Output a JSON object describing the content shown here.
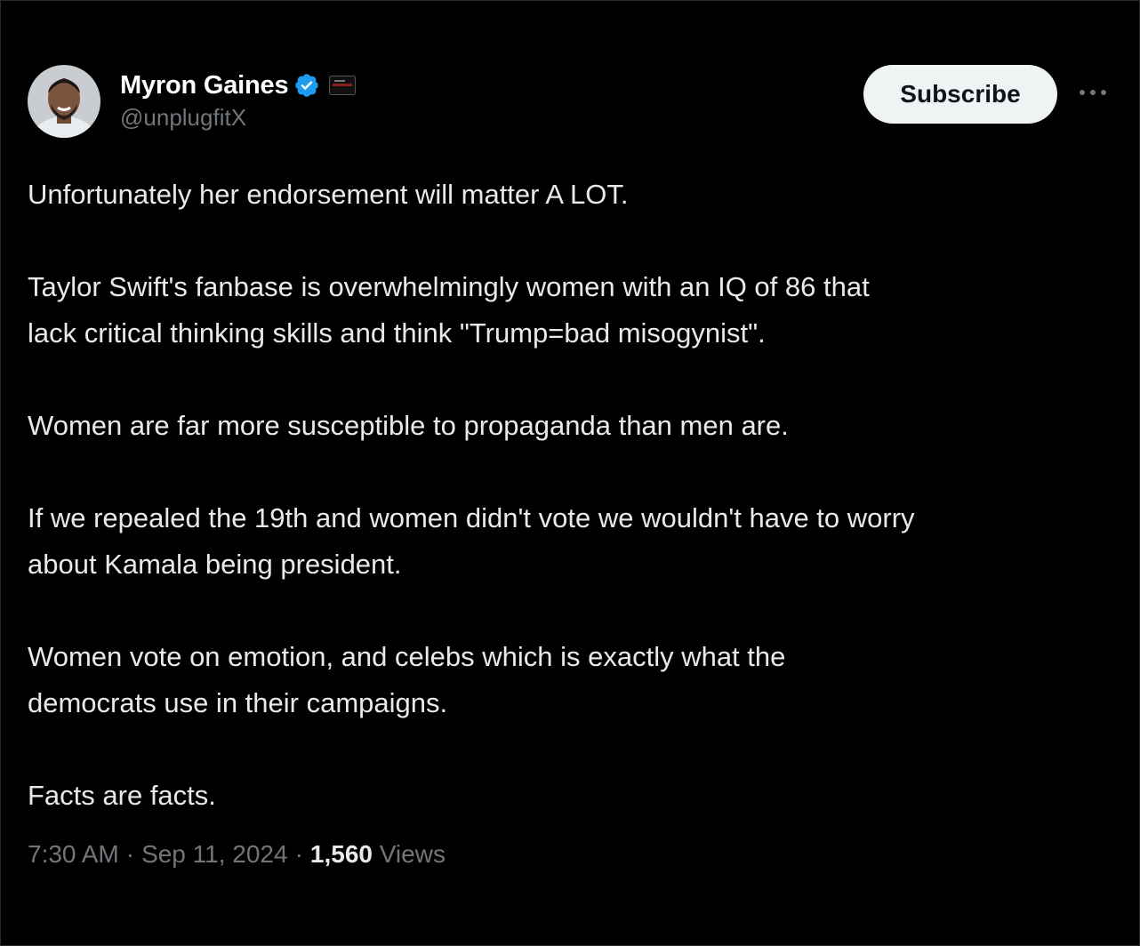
{
  "author": {
    "display_name": "Myron Gaines",
    "handle": "@unplugfitX",
    "verified": true,
    "verified_icon": "verified-badge-icon",
    "affiliate_icon": "affiliate-badge-icon",
    "avatar": "avatar-photo"
  },
  "actions": {
    "subscribe_label": "Subscribe",
    "more_icon": "more-options-icon"
  },
  "post": {
    "paragraphs": [
      "Unfortunately her endorsement will matter A LOT.",
      "Taylor Swift's fanbase is overwhelmingly women with an IQ of 86 that\nlack critical thinking skills and think \"Trump=bad misogynist\".",
      "Women are far more susceptible to propaganda than men are.",
      "If we repealed the 19th and women didn't vote we wouldn't have to worry\nabout Kamala being president.",
      "Women vote on emotion, and celebs which is exactly what the\ndemocrats use in their campaigns.",
      "Facts are facts."
    ]
  },
  "meta": {
    "time": "7:30 AM",
    "date": "Sep 11, 2024",
    "separator": "·",
    "views_count": "1,560",
    "views_label": "Views"
  },
  "colors": {
    "background": "#000000",
    "text": "#e7e9ea",
    "muted": "#71767b",
    "verified_blue": "#1d9bf0",
    "button_bg": "#eff3f4"
  }
}
